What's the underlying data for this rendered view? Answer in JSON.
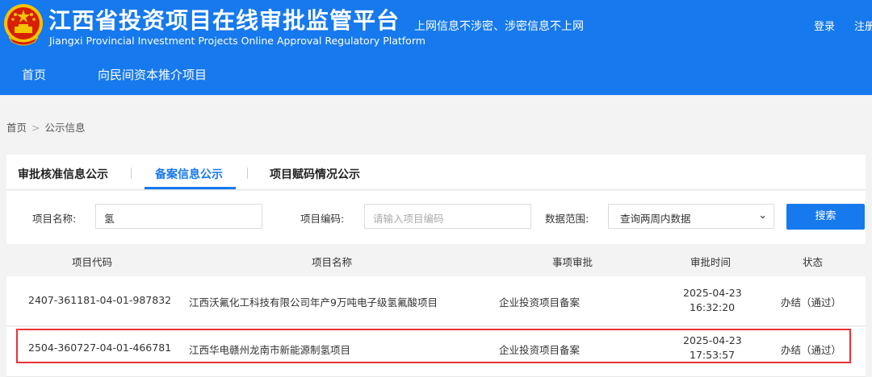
{
  "header": {
    "title": "江西省投资项目在线审批监管平台",
    "subtitle": "Jiangxi Provincial Investment Projects Online Approval Regulatory Platform",
    "notice": "上网信息不涉密、涉密信息不上网",
    "login": "登录",
    "register": "注册",
    "logo_icon": "national-emblem-icon",
    "colors": {
      "primary": "#1679ed",
      "highlight": "#e8333a"
    }
  },
  "nav": {
    "items": [
      "首页",
      "向民间资本推介项目"
    ]
  },
  "breadcrumb": {
    "home": "首页",
    "separator": ">",
    "current": "公示信息"
  },
  "tabs": {
    "items": [
      "审批核准信息公示",
      "备案信息公示",
      "项目赋码情况公示"
    ],
    "active": "备案信息公示"
  },
  "search": {
    "name_label": "项目名称:",
    "name_value": "氢",
    "code_label": "项目编码:",
    "code_placeholder": "请输入项目编码",
    "range_label": "数据范围:",
    "range_value": "查询两周内数据",
    "button": "搜索"
  },
  "table": {
    "columns": [
      "项目代码",
      "项目名称",
      "事项审批",
      "审批时间",
      "状态"
    ],
    "rows": [
      {
        "code": "2407-361181-04-01-987832",
        "name": "江西沃氟化工科技有限公司年产9万吨电子级氢氟酸项目",
        "matter": "企业投资项目备案",
        "date": "2025-04-23",
        "time": "16:32:20",
        "status": "办结（通过）"
      },
      {
        "code": "2504-360727-04-01-466781",
        "name": "江西华电赣州龙南市新能源制氢项目",
        "matter": "企业投资项目备案",
        "date": "2025-04-23",
        "time": "17:53:57",
        "status": "办结（通过）"
      }
    ]
  }
}
